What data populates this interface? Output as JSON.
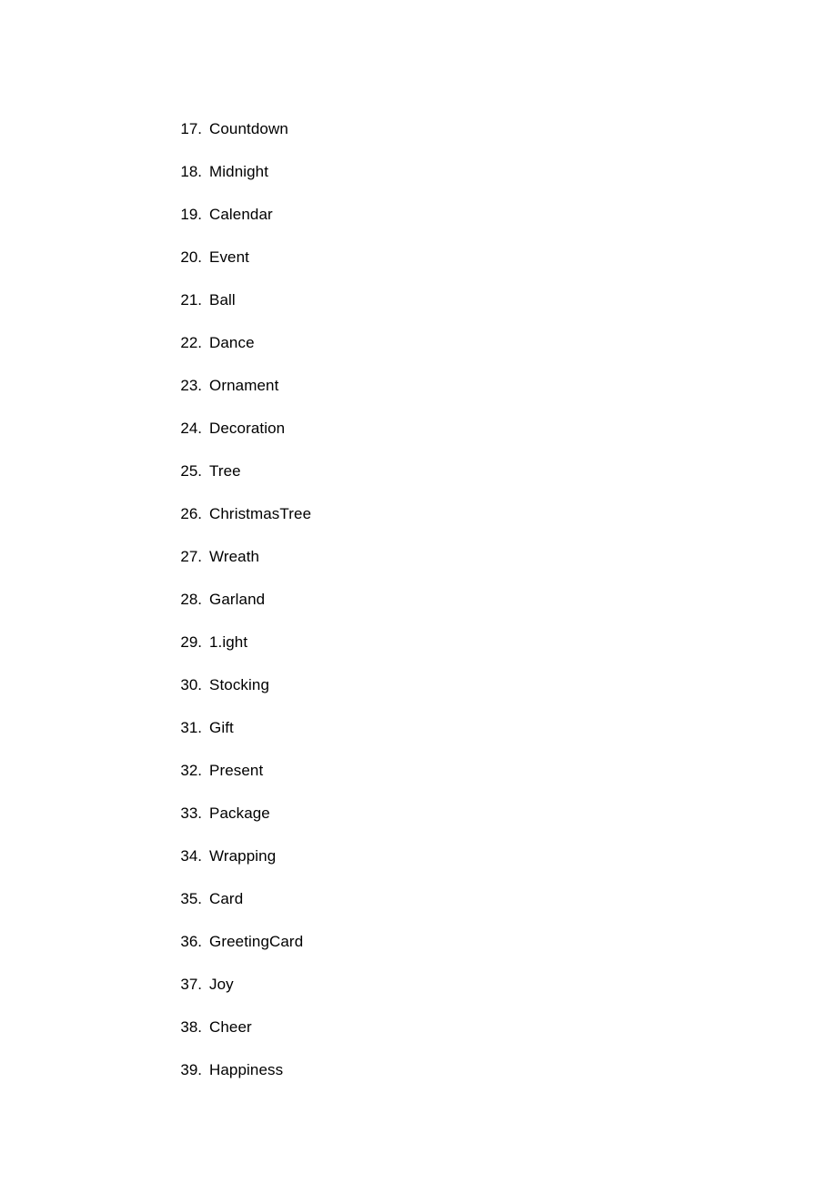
{
  "page": {
    "background_color": "#ffffff",
    "text_color": "#000000"
  },
  "list": {
    "start_number": 17,
    "end_number": 39,
    "marker_suffix": ".",
    "items": [
      {
        "number": "17.",
        "label": "Countdown"
      },
      {
        "number": "18.",
        "label": "Midnight"
      },
      {
        "number": "19.",
        "label": "Calendar"
      },
      {
        "number": "20.",
        "label": "Event"
      },
      {
        "number": "21.",
        "label": "Ball"
      },
      {
        "number": "22.",
        "label": "Dance"
      },
      {
        "number": "23.",
        "label": "Ornament"
      },
      {
        "number": "24.",
        "label": "Decoration"
      },
      {
        "number": "25.",
        "label": "Tree"
      },
      {
        "number": "26.",
        "label": "ChristmasTree"
      },
      {
        "number": "27.",
        "label": "Wreath"
      },
      {
        "number": "28.",
        "label": "Garland"
      },
      {
        "number": "29.",
        "label": "1.ight"
      },
      {
        "number": "30.",
        "label": "Stocking"
      },
      {
        "number": "31.",
        "label": "Gift"
      },
      {
        "number": "32.",
        "label": "Present"
      },
      {
        "number": "33.",
        "label": "Package"
      },
      {
        "number": "34.",
        "label": "Wrapping"
      },
      {
        "number": "35.",
        "label": "Card"
      },
      {
        "number": "36.",
        "label": "GreetingCard"
      },
      {
        "number": "37.",
        "label": "Joy"
      },
      {
        "number": "38.",
        "label": "Cheer"
      },
      {
        "number": "39.",
        "label": "Happiness"
      }
    ]
  }
}
